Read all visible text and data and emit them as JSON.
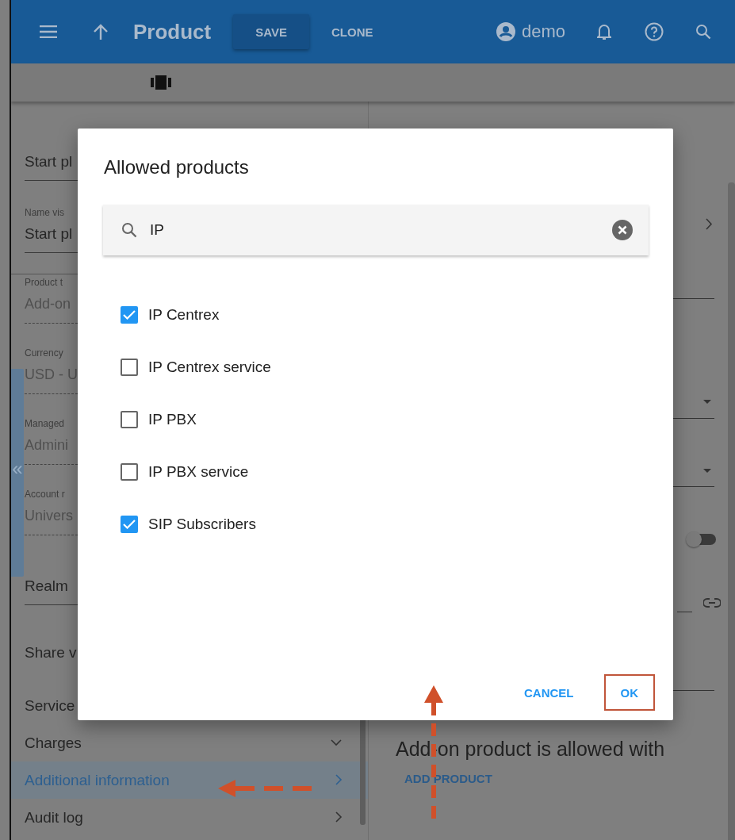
{
  "topbar": {
    "title": "Product",
    "buttons": [
      {
        "label": "SAVE",
        "kind": "raised"
      },
      {
        "label": "CLONE",
        "kind": "flat"
      }
    ],
    "user": "demo"
  },
  "left_panel": {
    "fields": [
      {
        "kind": "plain",
        "value": "Start pl"
      },
      {
        "kind": "labeled",
        "label": "Name vis",
        "value": "Start pl"
      },
      {
        "kind": "divider"
      },
      {
        "kind": "readonly",
        "label": "Product t",
        "value": "Add-on"
      },
      {
        "kind": "readonly",
        "label": "Currency",
        "value": "USD - U"
      },
      {
        "kind": "readonly",
        "label": "Managed",
        "value": "Admini"
      },
      {
        "kind": "readonly",
        "label": "Account r",
        "value": "Univers"
      },
      {
        "kind": "plain",
        "value": "Realm"
      },
      {
        "kind": "text",
        "value": "Share v"
      }
    ],
    "sections": [
      {
        "label": "Service",
        "selected": false,
        "kind": "plain"
      },
      {
        "label": "Charges",
        "selected": false,
        "kind": "group"
      },
      {
        "label": "Additional information",
        "selected": true,
        "kind": "link"
      },
      {
        "label": "Audit log",
        "selected": false,
        "kind": "link"
      }
    ],
    "collapse_label": "«"
  },
  "right_panel": {
    "toggle": {
      "on": false
    },
    "note": "Add-on product is allowed with",
    "add_button": "ADD PRODUCT"
  },
  "dialog": {
    "title": "Allowed products",
    "search": {
      "value": "IP"
    },
    "options": [
      {
        "label": "IP Centrex",
        "checked": true
      },
      {
        "label": "IP Centrex service",
        "checked": false
      },
      {
        "label": "IP PBX",
        "checked": false
      },
      {
        "label": "IP PBX service",
        "checked": false
      },
      {
        "label": "SIP Subscribers",
        "checked": true
      }
    ],
    "buttons": [
      {
        "label": "CANCEL",
        "highlighted": false
      },
      {
        "label": "OK",
        "highlighted": true
      }
    ]
  }
}
